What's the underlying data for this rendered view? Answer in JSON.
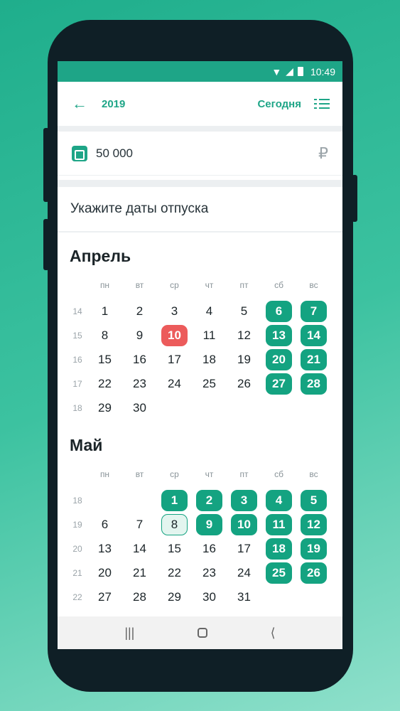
{
  "statusbar": {
    "time": "10:49"
  },
  "appbar": {
    "year": "2019",
    "today_label": "Сегодня"
  },
  "budget": {
    "amount": "50 000",
    "currency": "₽"
  },
  "prompt": "Укажите даты отпуска",
  "colors": {
    "accent": "#14a381",
    "today": "#ec5b5b"
  },
  "weekdays": [
    "пн",
    "вт",
    "ср",
    "чт",
    "пт",
    "сб",
    "вс"
  ],
  "months": [
    {
      "name": "Апрель",
      "weeks": [
        {
          "num": "14",
          "days": [
            [
              "1",
              ""
            ],
            [
              "2",
              ""
            ],
            [
              "3",
              ""
            ],
            [
              "4",
              ""
            ],
            [
              "5",
              ""
            ],
            [
              "6",
              "sel"
            ],
            [
              "7",
              "sel"
            ]
          ]
        },
        {
          "num": "15",
          "days": [
            [
              "8",
              ""
            ],
            [
              "9",
              ""
            ],
            [
              "10",
              "today"
            ],
            [
              "11",
              ""
            ],
            [
              "12",
              ""
            ],
            [
              "13",
              "sel"
            ],
            [
              "14",
              "sel"
            ]
          ]
        },
        {
          "num": "16",
          "days": [
            [
              "15",
              ""
            ],
            [
              "16",
              ""
            ],
            [
              "17",
              ""
            ],
            [
              "18",
              ""
            ],
            [
              "19",
              ""
            ],
            [
              "20",
              "sel"
            ],
            [
              "21",
              "sel"
            ]
          ]
        },
        {
          "num": "17",
          "days": [
            [
              "22",
              ""
            ],
            [
              "23",
              ""
            ],
            [
              "24",
              ""
            ],
            [
              "25",
              ""
            ],
            [
              "26",
              ""
            ],
            [
              "27",
              "sel"
            ],
            [
              "28",
              "sel"
            ]
          ]
        },
        {
          "num": "18",
          "days": [
            [
              "29",
              ""
            ],
            [
              "30",
              ""
            ],
            [
              "",
              ""
            ],
            [
              "",
              ""
            ],
            [
              "",
              ""
            ],
            [
              "",
              ""
            ],
            [
              "",
              ""
            ]
          ]
        }
      ]
    },
    {
      "name": "Май",
      "weeks": [
        {
          "num": "18",
          "days": [
            [
              "",
              ""
            ],
            [
              "",
              ""
            ],
            [
              "1",
              "sel"
            ],
            [
              "2",
              "sel"
            ],
            [
              "3",
              "sel"
            ],
            [
              "4",
              "sel"
            ],
            [
              "5",
              "sel"
            ]
          ]
        },
        {
          "num": "19",
          "days": [
            [
              "6",
              ""
            ],
            [
              "7",
              ""
            ],
            [
              "8",
              "outline"
            ],
            [
              "9",
              "sel"
            ],
            [
              "10",
              "sel"
            ],
            [
              "11",
              "sel"
            ],
            [
              "12",
              "sel"
            ]
          ]
        },
        {
          "num": "20",
          "days": [
            [
              "13",
              ""
            ],
            [
              "14",
              ""
            ],
            [
              "15",
              ""
            ],
            [
              "16",
              ""
            ],
            [
              "17",
              ""
            ],
            [
              "18",
              "sel"
            ],
            [
              "19",
              "sel"
            ]
          ]
        },
        {
          "num": "21",
          "days": [
            [
              "20",
              ""
            ],
            [
              "21",
              ""
            ],
            [
              "22",
              ""
            ],
            [
              "23",
              ""
            ],
            [
              "24",
              ""
            ],
            [
              "25",
              "sel"
            ],
            [
              "26",
              "sel"
            ]
          ]
        },
        {
          "num": "22",
          "days": [
            [
              "27",
              ""
            ],
            [
              "28",
              ""
            ],
            [
              "29",
              ""
            ],
            [
              "30",
              ""
            ],
            [
              "31",
              ""
            ],
            [
              "",
              ""
            ],
            [
              "",
              ""
            ]
          ]
        }
      ]
    }
  ]
}
